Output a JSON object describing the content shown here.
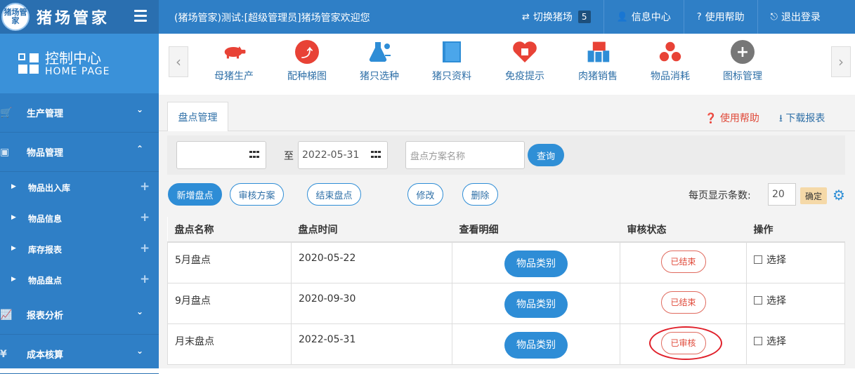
{
  "header": {
    "logo_badge": "猪场管家",
    "logo_text": "猪场管家",
    "welcome": "(猪场管家)测试:[超级管理员]猪场管家欢迎您",
    "actions": [
      {
        "icon": "⇄",
        "label": "切换猪场",
        "badge": "5"
      },
      {
        "icon": "👤",
        "label": "信息中心"
      },
      {
        "icon": "?",
        "label": "使用帮助"
      },
      {
        "icon": "⎋",
        "label": "退出登录"
      }
    ]
  },
  "sidebar": {
    "control_title": "控制中心",
    "control_sub": "HOME PAGE",
    "groups": [
      {
        "label": "生产管理",
        "icon": "cart-icon",
        "chev": "⌄"
      },
      {
        "label": "物品管理",
        "icon": "box-icon",
        "chev": "⌃"
      }
    ],
    "sub_items": [
      "物品出入库",
      "物品信息",
      "库存报表",
      "物品盘点"
    ],
    "groups_after": [
      {
        "label": "报表分析",
        "icon": "chart-icon",
        "chev": "⌄"
      },
      {
        "label": "成本核算",
        "icon": "money-icon",
        "chev": "⌄"
      }
    ]
  },
  "quick_icons": [
    {
      "label": "母猪生产",
      "icon": "pig-icon"
    },
    {
      "label": "配种梯图",
      "icon": "stairs-icon"
    },
    {
      "label": "猪只选种",
      "icon": "flask-icon"
    },
    {
      "label": "猪只资料",
      "icon": "book-icon"
    },
    {
      "label": "免疫提示",
      "icon": "heart-icon"
    },
    {
      "label": "肉猪销售",
      "icon": "sales-icon"
    },
    {
      "label": "物品消耗",
      "icon": "coins-icon"
    },
    {
      "label": "图标管理",
      "icon": "plus-icon"
    }
  ],
  "tab": {
    "label": "盘点管理"
  },
  "links": {
    "help": "使用帮助",
    "download": "下载报表"
  },
  "filter": {
    "start_date": "",
    "to_label": "至",
    "end_date": "2022-05-31",
    "plan_placeholder": "盘点方案名称",
    "query_label": "查询"
  },
  "toolbar": {
    "buttons": [
      "新增盘点",
      "审核方案",
      "结束盘点",
      "修改",
      "删除"
    ],
    "perpage_label": "每页显示条数:",
    "perpage_value": "20",
    "confirm_label": "确定"
  },
  "table": {
    "headers": [
      "盘点名称",
      "盘点时间",
      "查看明细",
      "审核状态",
      "操作"
    ],
    "rows": [
      {
        "name": "5月盘点",
        "date": "2020-05-22",
        "detail": "物品类别",
        "status": "已结束",
        "op": "选择"
      },
      {
        "name": "9月盘点",
        "date": "2020-09-30",
        "detail": "物品类别",
        "status": "已结束",
        "op": "选择"
      },
      {
        "name": "月末盘点",
        "date": "2022-05-31",
        "detail": "物品类别",
        "status": "已审核",
        "op": "选择"
      }
    ]
  },
  "colors": {
    "primary": "#2f7fc6",
    "accent": "#2e8dd6",
    "danger": "#e04a3a"
  }
}
